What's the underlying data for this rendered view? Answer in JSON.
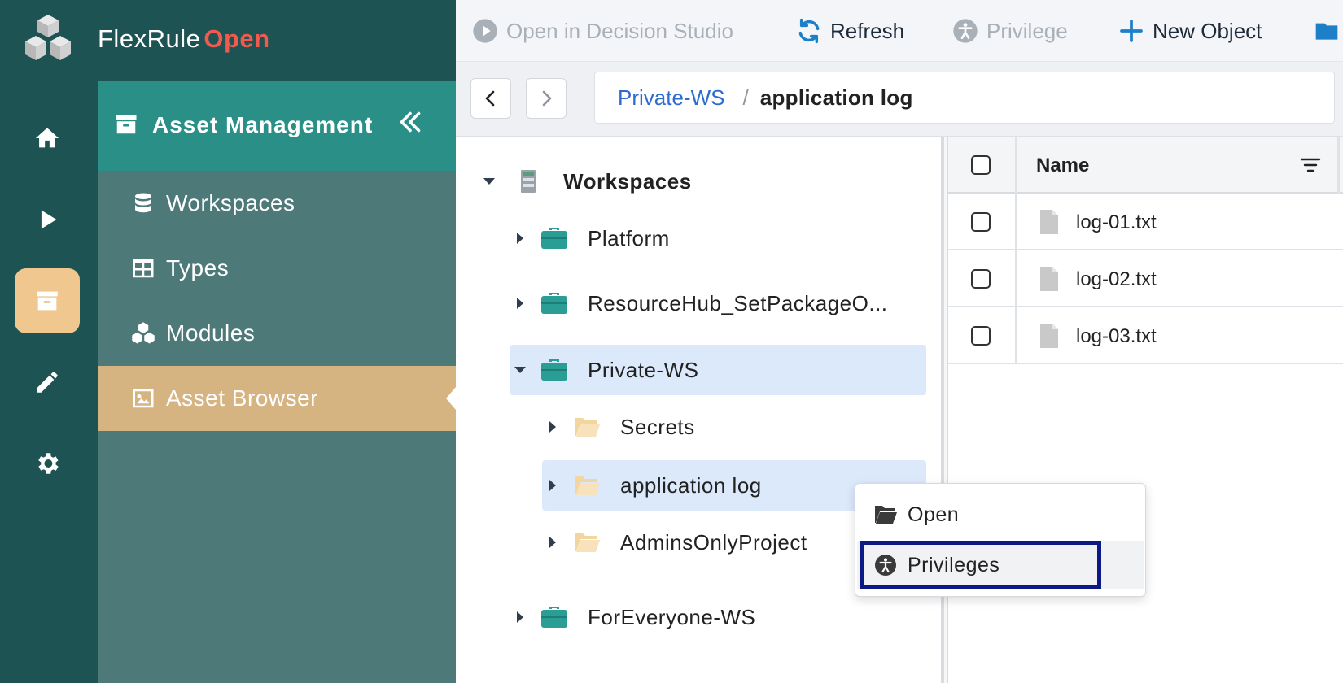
{
  "app": {
    "name": "FlexRule",
    "name_accent": "Open"
  },
  "rail": {
    "items": [
      {
        "icon": "home-icon"
      },
      {
        "icon": "play-icon"
      },
      {
        "icon": "archive-icon",
        "active": true
      },
      {
        "icon": "pencil-icon"
      },
      {
        "icon": "gear-icon"
      }
    ]
  },
  "panel": {
    "title": "Asset Management",
    "items": [
      {
        "label": "Workspaces",
        "icon": "database-icon"
      },
      {
        "label": "Types",
        "icon": "table-icon"
      },
      {
        "label": "Modules",
        "icon": "cubes-icon"
      },
      {
        "label": "Asset Browser",
        "icon": "image-gallery-icon",
        "active": true
      }
    ]
  },
  "toolbar": {
    "open_studio": "Open in Decision Studio",
    "refresh": "Refresh",
    "privilege": "Privilege",
    "new_object": "New Object"
  },
  "breadcrumb": {
    "parent": "Private-WS",
    "separator": "/",
    "current": "application log"
  },
  "tree": {
    "root": "Workspaces",
    "items": [
      {
        "label": "Platform",
        "type": "workspace"
      },
      {
        "label": "ResourceHub_SetPackageO...",
        "type": "workspace"
      },
      {
        "label": "Private-WS",
        "type": "workspace",
        "expanded": true,
        "selected": true
      },
      {
        "label": "Secrets",
        "type": "folder"
      },
      {
        "label": "application log",
        "type": "folder",
        "selected": true
      },
      {
        "label": "AdminsOnlyProject",
        "type": "folder"
      },
      {
        "label": "ForEveryone-WS",
        "type": "workspace"
      }
    ]
  },
  "grid": {
    "column_name": "Name",
    "files": [
      "log-01.txt",
      "log-02.txt",
      "log-03.txt"
    ]
  },
  "context_menu": {
    "open": "Open",
    "privileges": "Privileges"
  },
  "colors": {
    "rail_bg": "#1e5354",
    "panel_bg": "#4e7979",
    "panel_head": "#2a9087",
    "active_nav": "#d6b482",
    "accent_red": "#f25a4f",
    "workspace_teal": "#2a9d95",
    "folder_tan": "#f3d5a0",
    "highlight_navy": "#0b1a85"
  }
}
